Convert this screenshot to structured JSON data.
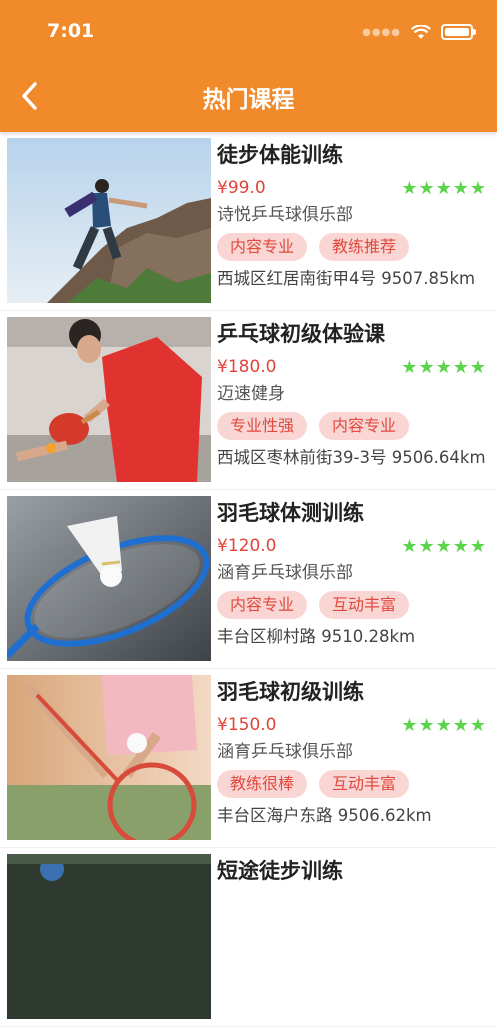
{
  "status": {
    "time": "7:01"
  },
  "header": {
    "title": "热门课程",
    "accent": "#f08a2b"
  },
  "courses": [
    {
      "title": "徒步体能训练",
      "price": "¥99.0",
      "stars": "★★★★★",
      "club": "诗悦乒乓球俱乐部",
      "tags": [
        "内容专业",
        "教练推荐"
      ],
      "address": "西城区红居南街甲4号 9507.85km",
      "image": "hiking-photo"
    },
    {
      "title": "乒乓球初级体验课",
      "price": "¥180.0",
      "stars": "★★★★★",
      "club": "迈速健身",
      "tags": [
        "专业性强",
        "内容专业"
      ],
      "address": "西城区枣林前街39-3号 9506.64km",
      "image": "table-tennis-photo"
    },
    {
      "title": "羽毛球体测训练",
      "price": "¥120.0",
      "stars": "★★★★★",
      "club": "涵育乒乓球俱乐部",
      "tags": [
        "内容专业",
        "互动丰富"
      ],
      "address": "丰台区柳村路 9510.28km",
      "image": "badminton-photo"
    },
    {
      "title": "羽毛球初级训练",
      "price": "¥150.0",
      "stars": "★★★★★",
      "club": "涵育乒乓球俱乐部",
      "tags": [
        "教练很棒",
        "互动丰富"
      ],
      "address": "丰台区海户东路 9506.62km",
      "image": "badminton-player-photo"
    },
    {
      "title": "短途徒步训练",
      "image": "hiking-photo-2"
    }
  ],
  "colors": {
    "price": "#e0443a",
    "stars": "#5ad44a",
    "tag_bg": "#f9d6d3",
    "tag_text": "#e04a3f"
  }
}
